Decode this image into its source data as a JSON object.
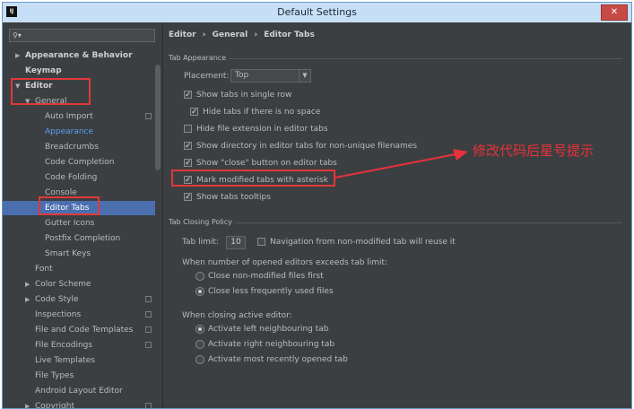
{
  "window": {
    "title": "Default Settings",
    "close": "✕",
    "app_icon": "IJ"
  },
  "search": {
    "placeholder": "",
    "icon": "search-icon"
  },
  "sidebar": {
    "items": [
      {
        "label": "Appearance & Behavior"
      },
      {
        "label": "Keymap"
      },
      {
        "label": "Editor"
      },
      {
        "label": "General"
      },
      {
        "label": "Auto Import"
      },
      {
        "label": "Appearance"
      },
      {
        "label": "Breadcrumbs"
      },
      {
        "label": "Code Completion"
      },
      {
        "label": "Code Folding"
      },
      {
        "label": "Console"
      },
      {
        "label": "Editor Tabs"
      },
      {
        "label": "Gutter Icons"
      },
      {
        "label": "Postfix Completion"
      },
      {
        "label": "Smart Keys"
      },
      {
        "label": "Font"
      },
      {
        "label": "Color Scheme"
      },
      {
        "label": "Code Style"
      },
      {
        "label": "Inspections"
      },
      {
        "label": "File and Code Templates"
      },
      {
        "label": "File Encodings"
      },
      {
        "label": "Live Templates"
      },
      {
        "label": "File Types"
      },
      {
        "label": "Android Layout Editor"
      },
      {
        "label": "Copyright"
      }
    ]
  },
  "breadcrumb": [
    "Editor",
    "›",
    "General",
    "›",
    "Editor Tabs"
  ],
  "tab_appearance": {
    "title": "Tab Appearance",
    "placement_label": "Placement:",
    "placement_value": "Top",
    "options": [
      {
        "label": "Show tabs in single row",
        "checked": true
      },
      {
        "label": "Hide tabs if there is no space",
        "checked": true
      },
      {
        "label": "Hide file extension in editor tabs",
        "checked": false
      },
      {
        "label": "Show directory in editor tabs for non-unique filenames",
        "checked": true
      },
      {
        "label": "Show \"close\" button on editor tabs",
        "checked": true
      },
      {
        "label": "Mark modified tabs with asterisk",
        "checked": true
      },
      {
        "label": "Show tabs tooltips",
        "checked": true
      }
    ]
  },
  "tab_closing": {
    "title": "Tab Closing Policy",
    "limit_label": "Tab limit:",
    "limit_value": "10",
    "nav_label": "Navigation from non-modified tab will reuse it",
    "exceed_label": "When number of opened editors exceeds tab limit:",
    "exceed_options": [
      {
        "label": "Close non-modified files first",
        "selected": false
      },
      {
        "label": "Close less frequently used files",
        "selected": true
      }
    ],
    "closing_label": "When closing active editor:",
    "closing_options": [
      {
        "label": "Activate left neighbouring tab",
        "selected": true
      },
      {
        "label": "Activate right neighbouring tab",
        "selected": false
      },
      {
        "label": "Activate most recently opened tab",
        "selected": false
      }
    ]
  },
  "annotation": {
    "text": "修改代码后星号提示",
    "color": "#e8313a"
  },
  "colors": {
    "accent": "#4b6eaf",
    "highlight": "#e0383b",
    "background": "#3c3f41"
  }
}
